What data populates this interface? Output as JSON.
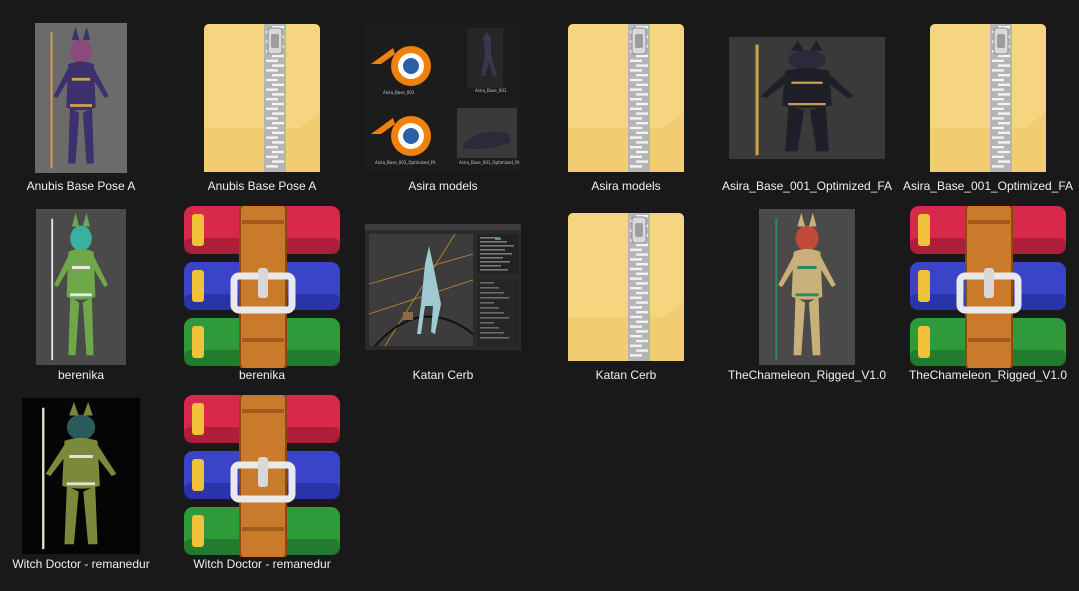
{
  "items": [
    {
      "label": "Anubis Base Pose A",
      "kind": "image",
      "bg": "#6b6b6b",
      "figure": "#3e2f6e",
      "accent": "#d4a24c",
      "figure_w": 92,
      "figure_h": 150,
      "tint": "#8a4a7a"
    },
    {
      "label": "Anubis Base Pose A",
      "kind": "zip"
    },
    {
      "label": "Asira models",
      "kind": "collage"
    },
    {
      "label": "Asira models",
      "kind": "zip"
    },
    {
      "label": "Asira_Base_001_Optimized_FA",
      "kind": "image",
      "bg": "#3a3a3a",
      "figure": "#1f1f2a",
      "accent": "#c8a14a",
      "figure_w": 156,
      "figure_h": 122,
      "tint": "#2a2a3a"
    },
    {
      "label": "Asira_Base_001_Optimized_FA",
      "kind": "zip"
    },
    {
      "label": "berenika",
      "kind": "image",
      "bg": "#4a4a4a",
      "figure": "#6fa84a",
      "accent": "#e8e8e8",
      "figure_w": 90,
      "figure_h": 156,
      "tint": "#3ab0a0"
    },
    {
      "label": "berenika",
      "kind": "rar"
    },
    {
      "label": "Katan Cerb",
      "kind": "blender"
    },
    {
      "label": "Katan Cerb",
      "kind": "zip"
    },
    {
      "label": "TheChameleon_Rigged_V1.0",
      "kind": "image",
      "bg": "#4a4a4a",
      "figure": "#c9b07a",
      "accent": "#2f8a5a",
      "figure_w": 96,
      "figure_h": 156,
      "tint": "#c04a3a"
    },
    {
      "label": "TheChameleon_Rigged_V1.0",
      "kind": "rar"
    },
    {
      "label": "Witch Doctor - remanedur",
      "kind": "image",
      "bg": "#050505",
      "figure": "#7a8a3a",
      "accent": "#e8e0d0",
      "figure_w": 118,
      "figure_h": 156,
      "tint": "#2a5a5a"
    },
    {
      "label": "Witch Doctor - remanedur",
      "kind": "rar"
    }
  ],
  "collage_captions": [
    "Asira_Base_001",
    "Asira_Base_001",
    "Asira_Base_001_Optimized_FA",
    "Asira_Base_001_Optimized_FA"
  ],
  "colors": {
    "background": "#191919",
    "label": "#f0f0f0",
    "folder": "#f6d581",
    "zipper": "#9a9a9a",
    "rar_red": "#d8294a",
    "rar_blue": "#3a44c8",
    "rar_green": "#2f9a3a",
    "rar_strap": "#c97a2a"
  }
}
